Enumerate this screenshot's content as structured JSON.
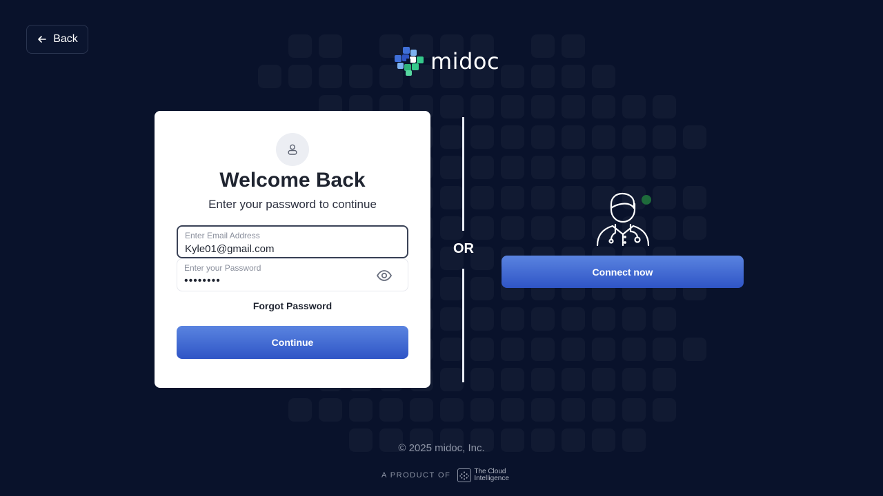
{
  "nav": {
    "back_label": "Back"
  },
  "brand": {
    "name": "midoc"
  },
  "login": {
    "title": "Welcome Back",
    "subtitle": "Enter your password to continue",
    "email": {
      "label": "Enter Email Address",
      "value": "Kyle01@gmail.com"
    },
    "password": {
      "label": "Enter your Password",
      "value": "••••••••"
    },
    "forgot_label": "Forgot Password",
    "continue_label": "Continue"
  },
  "divider": {
    "label": "OR"
  },
  "connect": {
    "button_label": "Connect now",
    "status_color": "#1e6b3b"
  },
  "footer": {
    "copyright": "© 2025 midoc, Inc.",
    "product_prefix": "A PRODUCT OF",
    "company_line1": "The Cloud",
    "company_line2": "Intelligence"
  },
  "colors": {
    "background": "#09122b",
    "accent": "#3b63d3",
    "card": "#ffffff"
  },
  "icons": [
    "arrow-left-icon",
    "user-icon",
    "eye-icon",
    "doctor-icon"
  ]
}
